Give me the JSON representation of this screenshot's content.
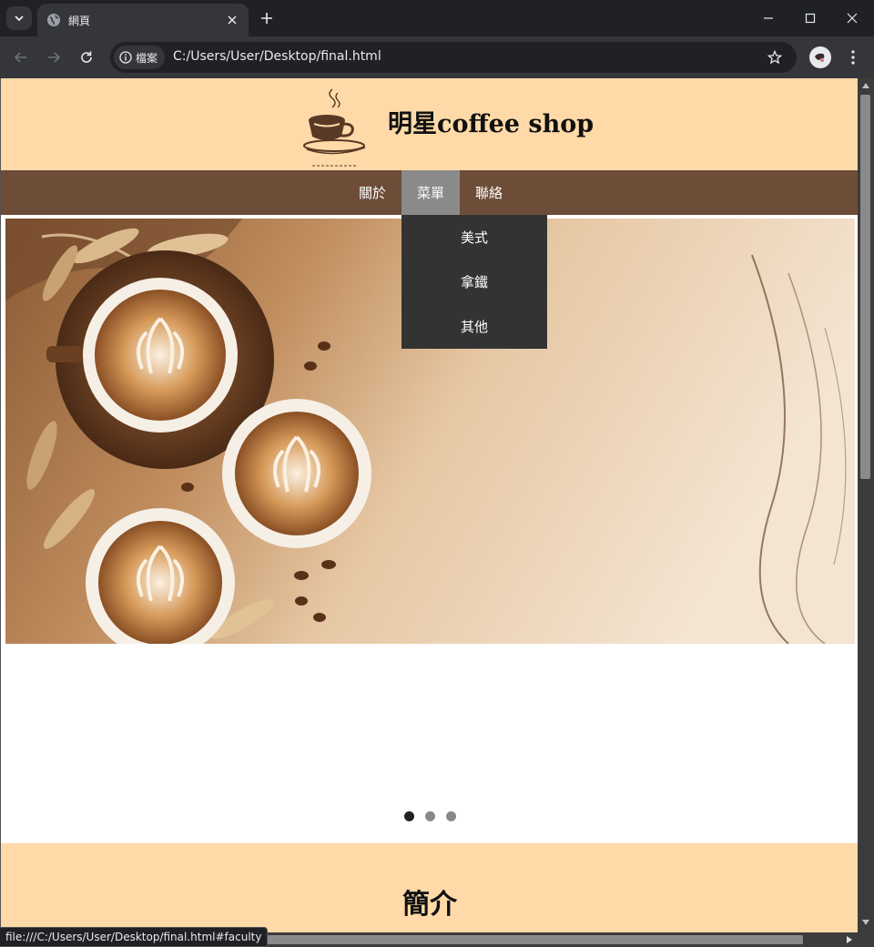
{
  "browser": {
    "tab_title": "網頁",
    "site_chip_label": "檔案",
    "url": "C:/Users/User/Desktop/final.html",
    "status_url": "file:///C:/Users/User/Desktop/final.html#faculty"
  },
  "header": {
    "shop_title": "明星coffee shop"
  },
  "nav": {
    "items": [
      {
        "label": "關於"
      },
      {
        "label": "菜單"
      },
      {
        "label": "聯絡"
      }
    ],
    "active_item": "菜單"
  },
  "dropdown": {
    "items": [
      {
        "label": "美式"
      },
      {
        "label": "拿鐵"
      },
      {
        "label": "其他"
      }
    ]
  },
  "carousel": {
    "slide_count": 3,
    "active_index": 0
  },
  "intro": {
    "heading": "簡介"
  },
  "colors": {
    "header_bg": "#ffdaa8",
    "nav_bg": "#6d4c38",
    "nav_active_bg": "#8a8a8a",
    "dropdown_bg": "#333333"
  }
}
